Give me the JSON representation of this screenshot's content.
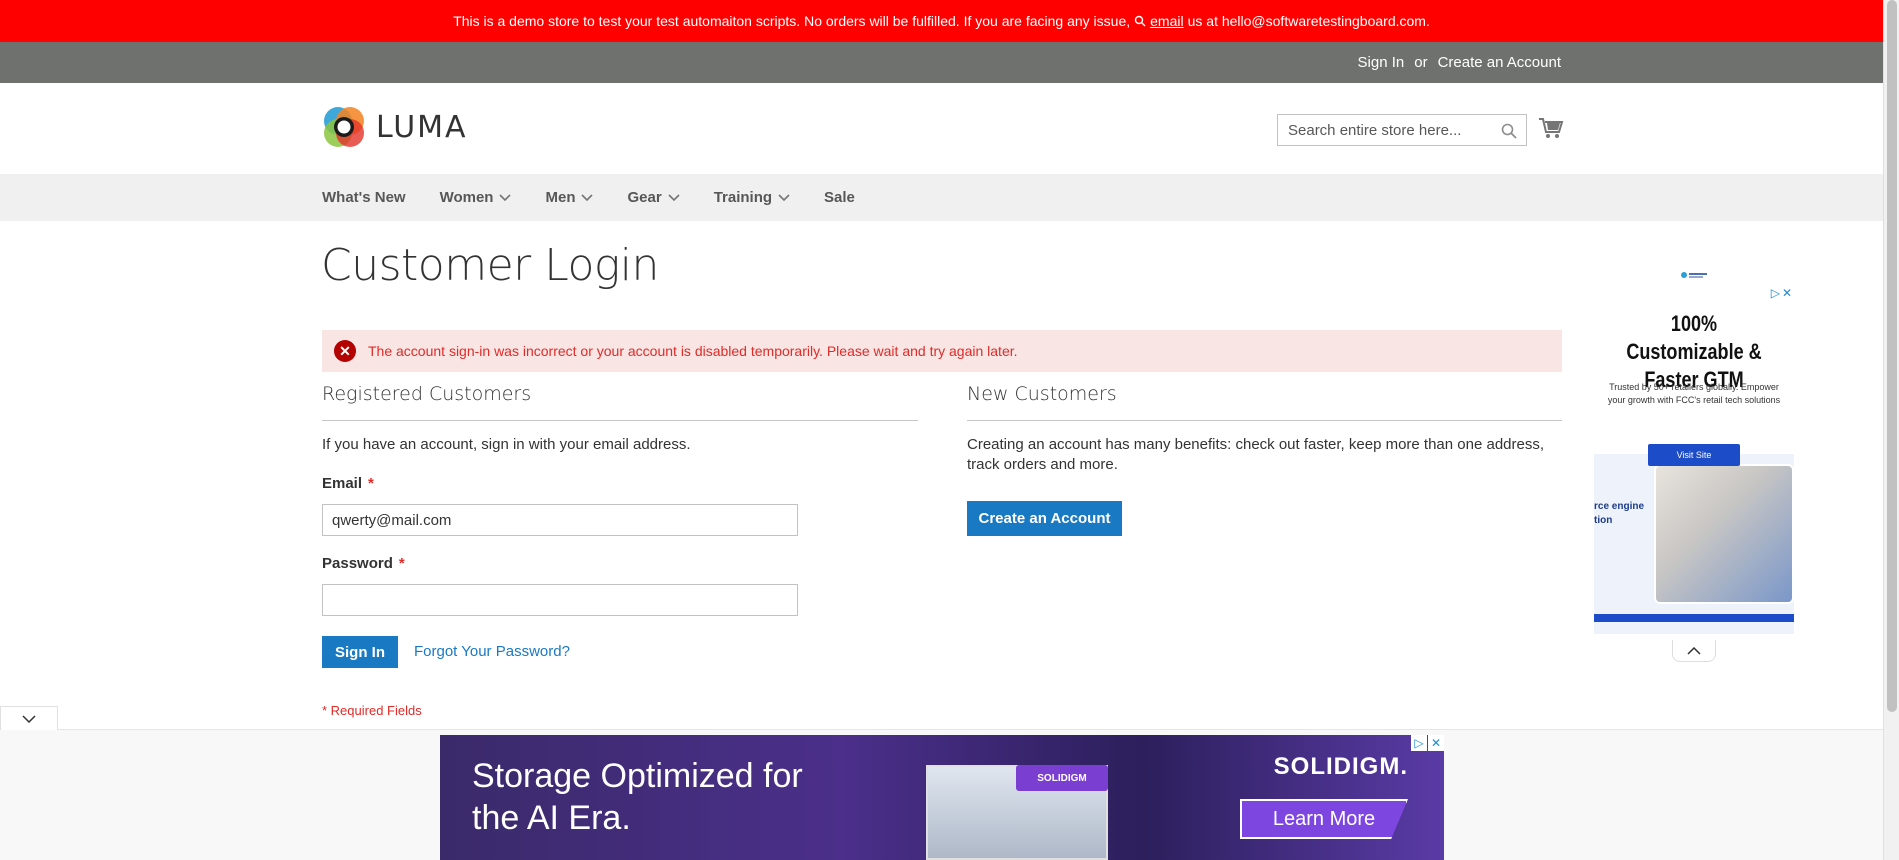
{
  "demo_banner": {
    "text_before": "This is a demo store to test your test automaiton scripts. No orders will be fulfilled. If you are facing any issue,",
    "email_link": "email",
    "text_after": "us at hello@softwaretestingboard.com."
  },
  "header_links": {
    "sign_in": "Sign In",
    "or": "or",
    "create_account": "Create an Account"
  },
  "logo": {
    "text": "LUMA"
  },
  "search": {
    "placeholder": "Search entire store here..."
  },
  "nav": {
    "items": [
      {
        "label": "What's New",
        "has_dropdown": false
      },
      {
        "label": "Women",
        "has_dropdown": true
      },
      {
        "label": "Men",
        "has_dropdown": true
      },
      {
        "label": "Gear",
        "has_dropdown": true
      },
      {
        "label": "Training",
        "has_dropdown": true
      },
      {
        "label": "Sale",
        "has_dropdown": false
      }
    ]
  },
  "page": {
    "title": "Customer Login",
    "error_message": "The account sign-in was incorrect or your account is disabled temporarily. Please wait and try again later."
  },
  "registered": {
    "title": "Registered Customers",
    "intro": "If you have an account, sign in with your email address.",
    "email_label": "Email",
    "email_value": "qwerty@mail.com",
    "password_label": "Password",
    "password_value": "",
    "required_marker": "*",
    "sign_in_button": "Sign In",
    "forgot_link": "Forgot Your Password?",
    "required_note": "* Required Fields"
  },
  "new_customers": {
    "title": "New Customers",
    "text": "Creating an account has many benefits: check out faster, keep more than one address, track orders and more.",
    "button": "Create an Account"
  },
  "side_ad": {
    "headline": "100% Customizable & Faster GTM",
    "subtext": "Trusted by 50+ retailers globally. Empower your growth with FCC's retail tech solutions",
    "visit_button": "Visit Site",
    "image_text": "rce engine\ntion"
  },
  "bottom_ad": {
    "headline": "Storage Optimized for the AI Era.",
    "brand": "SOLIDIGM.",
    "badge": "SOLIDIGM",
    "cta": "Learn More"
  },
  "colors": {
    "banner": "#ff0000",
    "header_panel": "#6e716e",
    "primary": "#1979c3",
    "error_bg": "#fae5e5",
    "error_text": "#e02b27"
  }
}
